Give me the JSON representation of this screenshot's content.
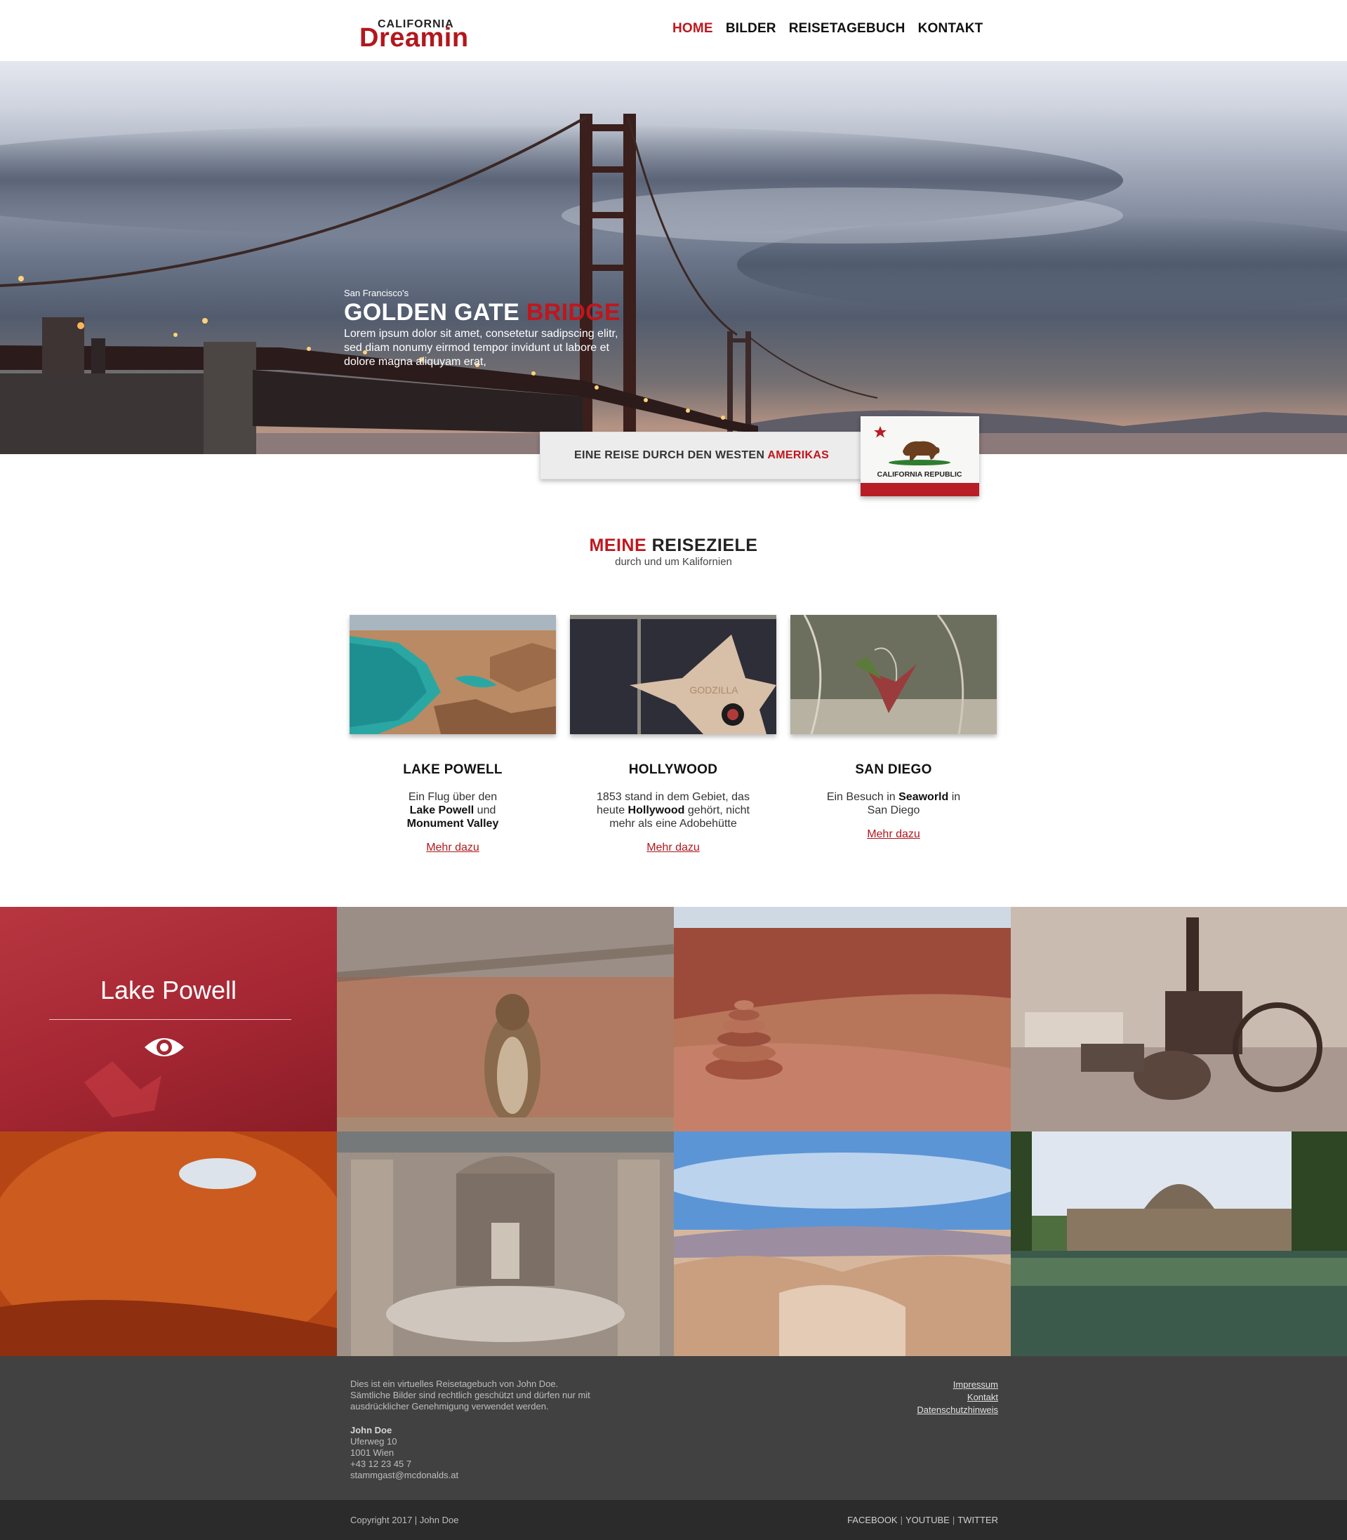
{
  "header": {
    "logo_top": "CALIFORNIA",
    "logo_main": "Dreamin",
    "nav": [
      {
        "label": "HOME",
        "active": true
      },
      {
        "label": "BILDER",
        "active": false
      },
      {
        "label": "REISETAGEBUCH",
        "active": false
      },
      {
        "label": "KONTAKT",
        "active": false
      }
    ]
  },
  "hero": {
    "subtitle": "San Francisco's",
    "title_main": "GOLDEN GATE",
    "title_accent": "BRIDGE",
    "description": "Lorem ipsum dolor sit amet, consetetur sadipscing elitr, sed diam nonumy eirmod tempor invidunt ut labore et dolore magna aliquyam erat,",
    "banner_text": "EINE REISE DURCH DEN WESTEN",
    "banner_accent": "AMERIKAS",
    "flag_label": "CALIFORNIA REPUBLIC"
  },
  "destinations": {
    "heading_accent": "MEINE",
    "heading_main": "REISEZIELE",
    "subtitle": "durch und um Kalifornien",
    "cards": [
      {
        "title": "LAKE POWELL",
        "desc_parts": [
          "Ein Flug über den",
          "Lake Powell",
          "und",
          "Monument Valley"
        ],
        "link": "Mehr dazu"
      },
      {
        "title": "HOLLYWOOD",
        "desc_parts": [
          "1853 stand in dem Gebiet, das heute",
          "Hollywood",
          "gehört, nicht mehr als eine Adobehütte"
        ],
        "link": "Mehr dazu"
      },
      {
        "title": "SAN DIEGO",
        "desc_parts": [
          "Ein Besuch in",
          "Seaworld",
          "in San Diego"
        ],
        "link": "Mehr dazu"
      }
    ]
  },
  "gallery": {
    "overlay_title": "Lake Powell"
  },
  "footer": {
    "about_lines": [
      "Dies ist ein virtuelles Reisetagebuch von John Doe.",
      "Sämtliche Bilder sind rechtlich geschützt und dürfen nur mit",
      "ausdrücklicher Genehmigung verwendet werden."
    ],
    "contact": {
      "name": "John Doe",
      "street": "Uferweg 10",
      "city": "1001 Wien",
      "phone": "+43 12 23 45 7",
      "email": "stammgast@mcdonalds.at"
    },
    "links": [
      "Impressum",
      "Kontakt",
      "Datenschutzhinweis"
    ],
    "copyright": "Copyright 2017 | John Doe",
    "social": [
      "FACEBOOK",
      "YOUTUBE",
      "TWITTER"
    ]
  },
  "colors": {
    "accent": "#c0161d",
    "footer_bg": "#414141",
    "bottom_bar_bg": "#2b2b2b",
    "overlay_red": "#a52733"
  }
}
